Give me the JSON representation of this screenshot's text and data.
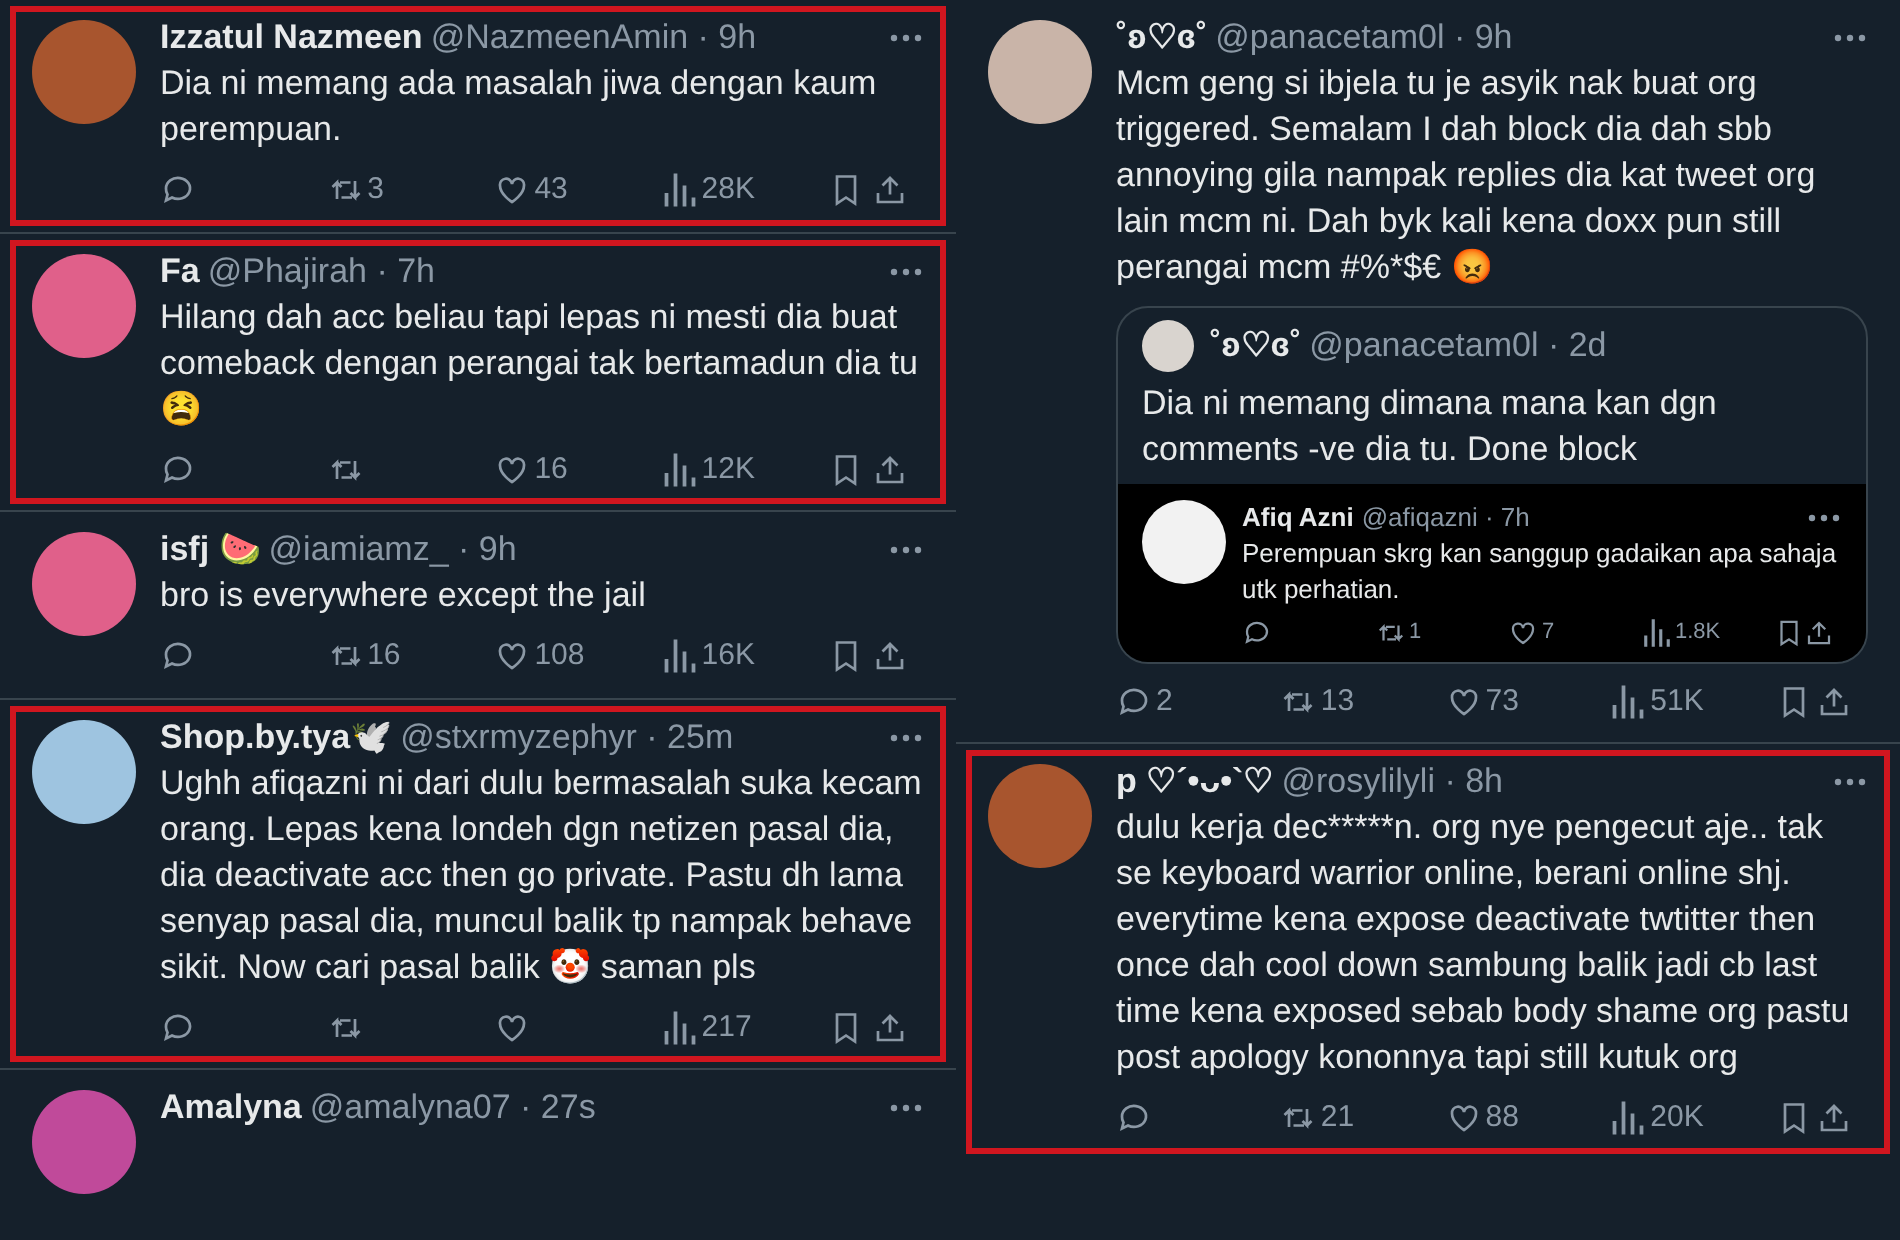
{
  "left_column": [
    {
      "name": "Izzatul Nazmeen",
      "meta": "@NazmeenAmin · 9h",
      "text": "Dia ni memang ada masalah jiwa dengan kaum perempuan.",
      "highlighted": true,
      "stats": {
        "retweets": "3",
        "likes": "43",
        "views": "28K"
      }
    },
    {
      "name": "Fa",
      "meta": "@Phajirah · 7h",
      "text": "Hilang dah acc beliau tapi lepas ni mesti dia buat comeback dengan perangai tak bertamadun dia tu 😫",
      "highlighted": true,
      "stats": {
        "likes": "16",
        "views": "12K"
      }
    },
    {
      "name": "isfj 🍉",
      "meta": "@iamiamz_ · 9h",
      "text": "bro is everywhere except the jail",
      "highlighted": false,
      "stats": {
        "retweets": "16",
        "likes": "108",
        "views": "16K"
      }
    },
    {
      "name": "Shop.by.tya🕊️",
      "meta": "@stxrmyzephyr · 25m",
      "text": "Ughh afiqazni ni dari dulu bermasalah suka kecam orang. Lepas kena londeh dgn netizen pasal dia, dia deactivate acc then go private. Pastu dh lama senyap pasal dia, muncul balik tp nampak behave sikit. Now cari pasal balik 🤡 saman pls",
      "highlighted": true,
      "stats": {
        "views": "217"
      }
    },
    {
      "name": "Amalyna",
      "meta": "@amalyna07 · 27s",
      "highlighted": false
    }
  ],
  "right_column": [
    {
      "name": "˚ʚ♡ɞ˚",
      "meta": "@panacetam0l · 9h",
      "text": "Mcm geng si ibjela tu je asyik nak buat org triggered. Semalam I dah block dia dah sbb annoying gila nampak replies dia kat tweet org lain mcm ni. Dah byk kali kena doxx pun still perangai mcm #%*$€ 😡",
      "highlighted": false,
      "quote": {
        "name": "˚ʚ♡ɞ˚",
        "meta": "@panacetam0l · 2d",
        "text": "Dia ni memang dimana mana kan dgn comments -ve dia tu. Done block",
        "embedded": {
          "name": "Afiq Azni",
          "meta": "@afiqazni · 7h",
          "text": "Perempuan skrg kan sanggup gadaikan apa sahaja utk perhatian.",
          "stats": {
            "retweets": "1",
            "likes": "7",
            "views": "1.8K"
          }
        }
      },
      "stats": {
        "replies": "2",
        "retweets": "13",
        "likes": "73",
        "views": "51K"
      }
    },
    {
      "name": "p ♡´•ᴗ•`♡",
      "meta": "@rosylilyli · 8h",
      "text": "dulu kerja dec*****n. org nye pengecut aje.. tak se keyboard warrior online, berani online shj. everytime kena expose deactivate twtitter then once dah cool down sambung balik jadi cb last time kena exposed sebab body shame org pastu post apology kononnya tapi still kutuk org",
      "highlighted": true,
      "stats": {
        "retweets": "21",
        "likes": "88",
        "views": "20K"
      }
    }
  ]
}
